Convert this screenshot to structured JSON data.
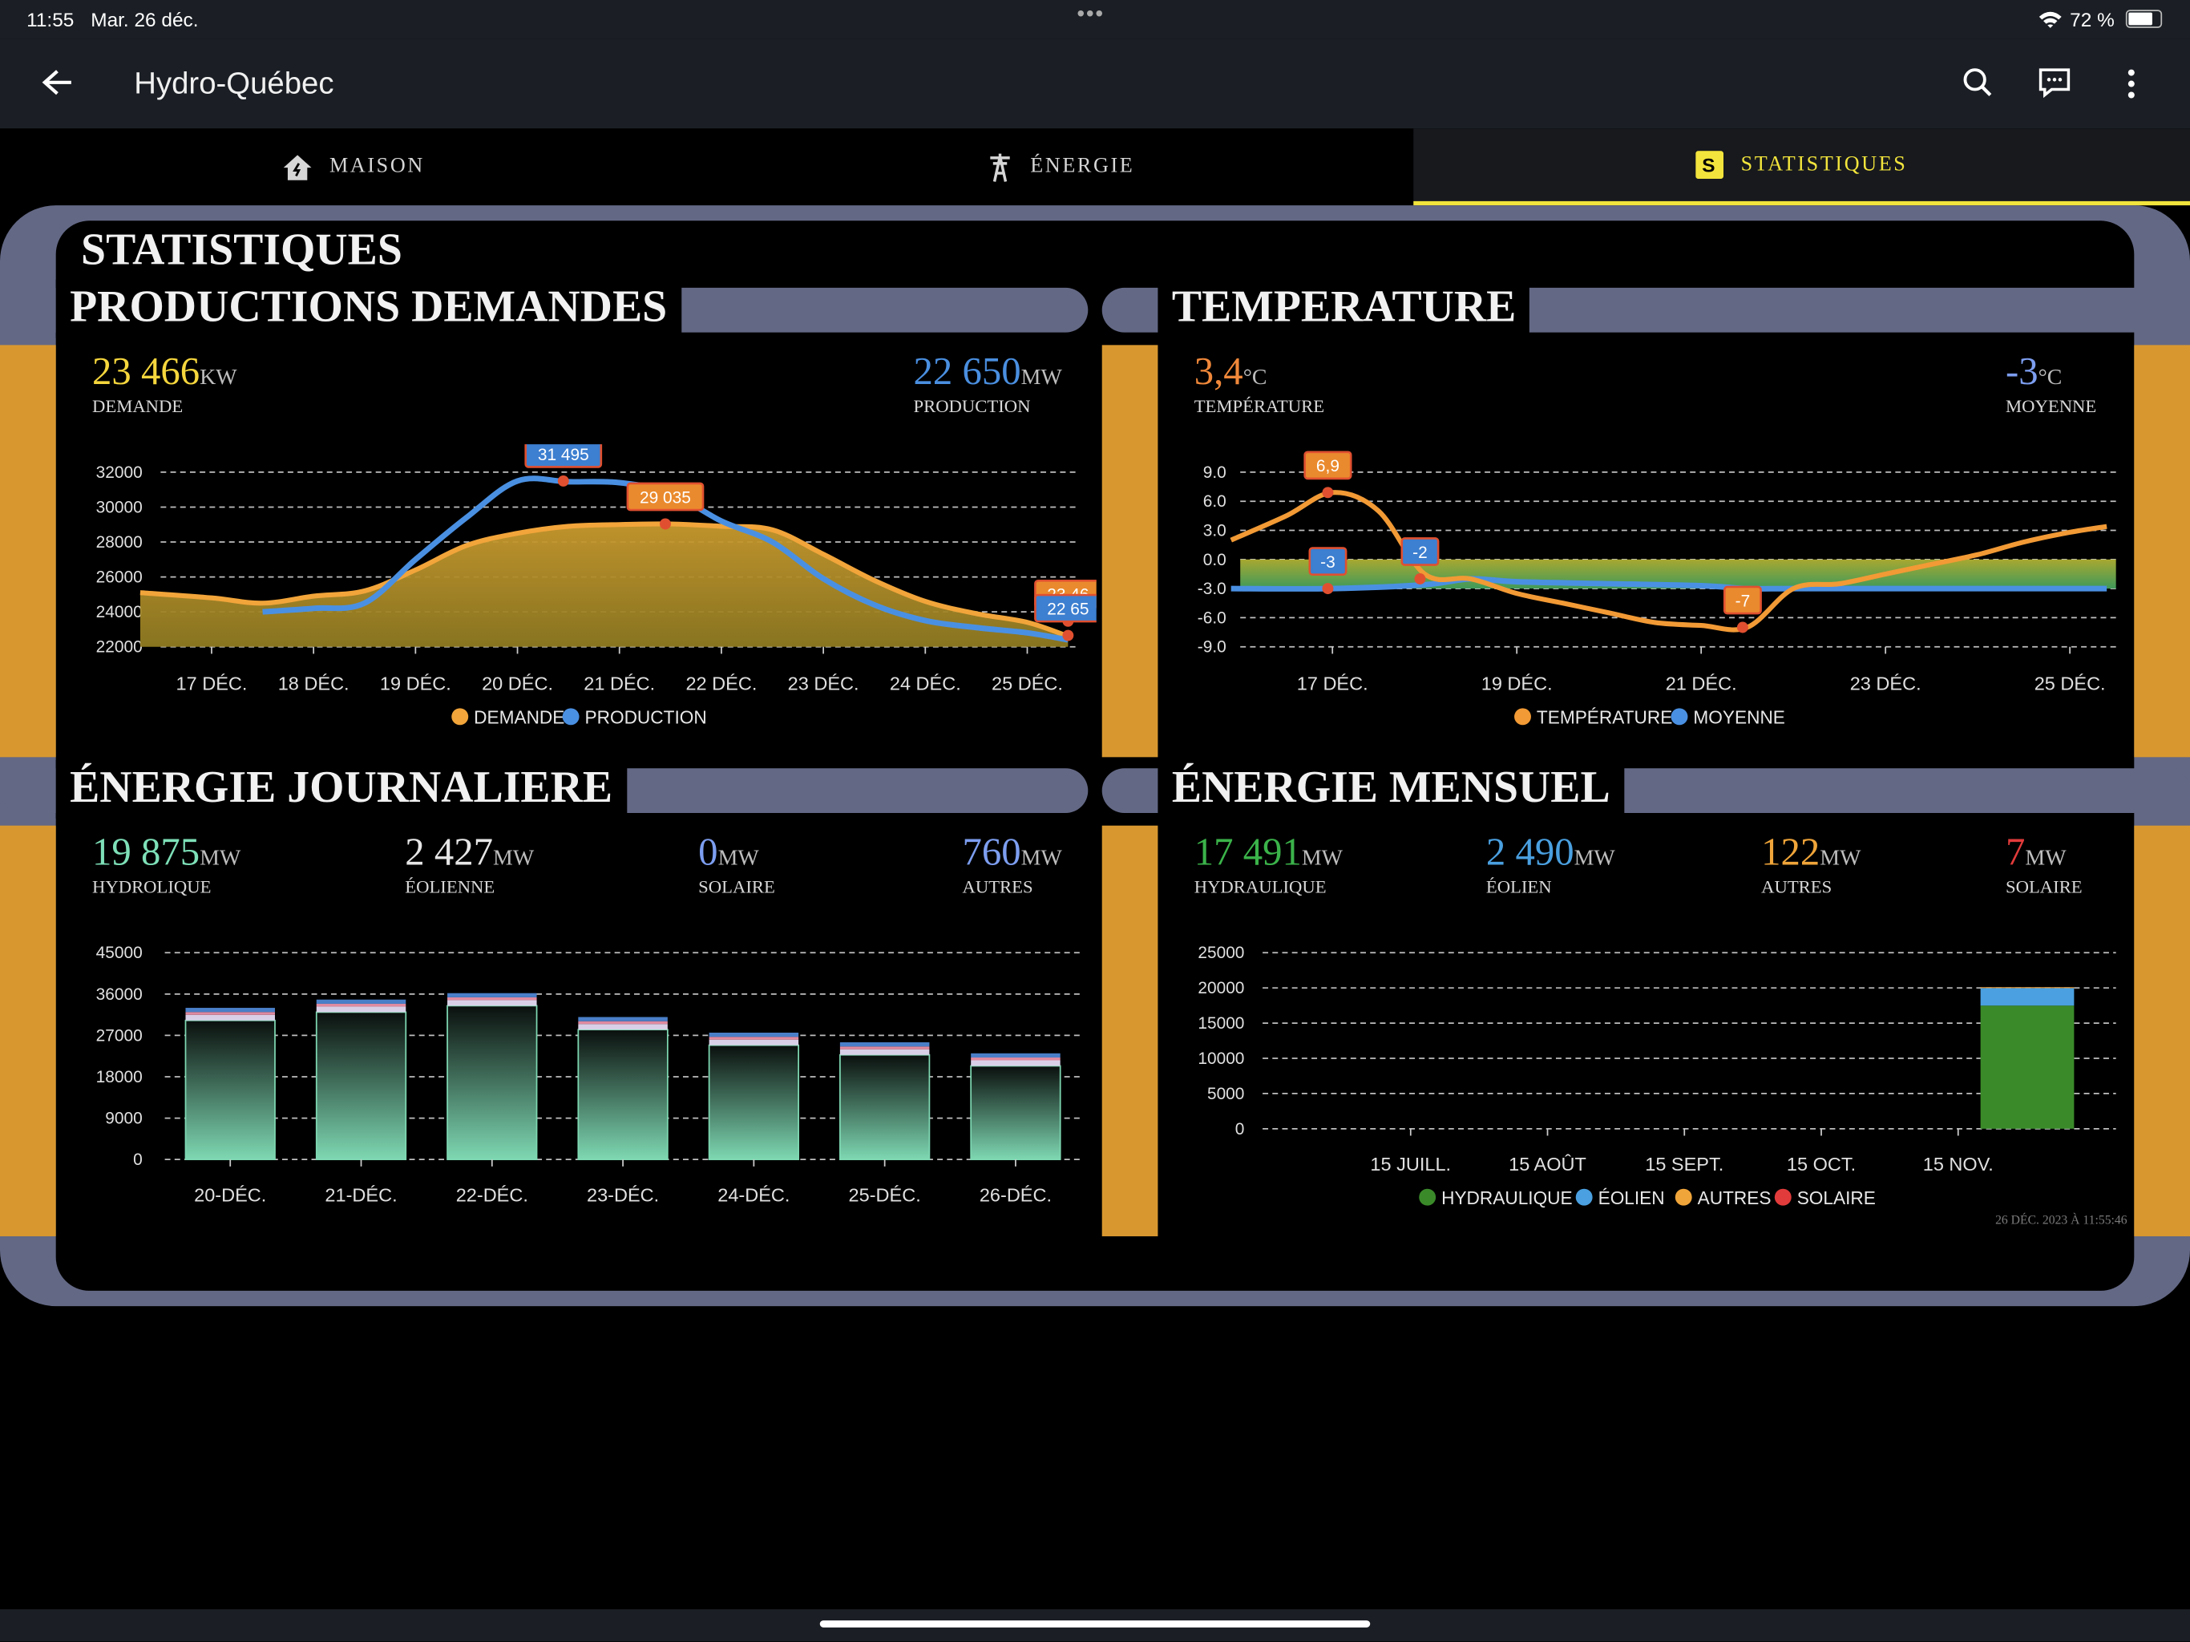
{
  "status": {
    "time": "11:55",
    "date": "Mar. 26 déc.",
    "battery": "72 %"
  },
  "app": {
    "title": "Hydro-Québec"
  },
  "tabs": [
    {
      "label": "MAISON"
    },
    {
      "label": "ÉNERGIE"
    },
    {
      "label": "STATISTIQUES"
    }
  ],
  "page_title": "STATISTIQUES",
  "panels": {
    "prod": {
      "title": "PRODUCTIONS DEMANDES",
      "stats": [
        {
          "value": "23 466",
          "unit": "KW",
          "label": "DEMANDE",
          "color": "#f5d63d"
        },
        {
          "value": "22 650",
          "unit": "MW",
          "label": "PRODUCTION",
          "color": "#4a8fe0"
        }
      ]
    },
    "temp": {
      "title": "TEMPERATURE",
      "stats": [
        {
          "value": "3,4",
          "unit": "°C",
          "label": "TEMPÉRATURE",
          "color": "#f0883a"
        },
        {
          "value": "-3",
          "unit": "°C",
          "label": "MOYENNE",
          "color": "#7d9ef0"
        }
      ]
    },
    "daily": {
      "title": "ÉNERGIE JOURNALIERE",
      "stats": [
        {
          "value": "19 875",
          "unit": "MW",
          "label": "HYDROLIQUE",
          "color": "#7ee0b8"
        },
        {
          "value": "2 427",
          "unit": "MW",
          "label": "ÉOLIENNE",
          "color": "#e6e6e6"
        },
        {
          "value": "0",
          "unit": "MW",
          "label": "SOLAIRE",
          "color": "#7d9ef0"
        },
        {
          "value": "760",
          "unit": "MW",
          "label": "AUTRES",
          "color": "#7d9ef0"
        }
      ]
    },
    "monthly": {
      "title": "ÉNERGIE MENSUEL",
      "stats": [
        {
          "value": "17 491",
          "unit": "MW",
          "label": "HYDRAULIQUE",
          "color": "#3bb34a"
        },
        {
          "value": "2 490",
          "unit": "MW",
          "label": "ÉOLIEN",
          "color": "#4aa0e0"
        },
        {
          "value": "122",
          "unit": "MW",
          "label": "AUTRES",
          "color": "#f0a53a"
        },
        {
          "value": "7",
          "unit": "MW",
          "label": "SOLAIRE",
          "color": "#e23b3b"
        }
      ]
    }
  },
  "timestamp": "26 DÉC. 2023 À 11:55:46",
  "chart_data": [
    {
      "type": "area",
      "xticks": [
        "17 DÉC.",
        "18 DÉC.",
        "19 DÉC.",
        "20 DÉC.",
        "21 DÉC.",
        "22 DÉC.",
        "23 DÉC.",
        "24 DÉC.",
        "25 DÉC."
      ],
      "yticks": [
        "32000",
        "30000",
        "28000",
        "26000",
        "24000",
        "22000"
      ],
      "ylim": [
        22000,
        32000
      ],
      "xlim": [
        16.5,
        25.5
      ],
      "series": [
        {
          "name": "DEMANDE",
          "color": "#f2a53a",
          "x": [
            16.3,
            17,
            17.5,
            18,
            18.5,
            19,
            19.5,
            20,
            20.5,
            21,
            21.5,
            22,
            22.5,
            23,
            23.5,
            24,
            24.5,
            25,
            25.4
          ],
          "values": [
            25100,
            24800,
            24500,
            24900,
            25200,
            26400,
            27800,
            28500,
            28900,
            29000,
            29035,
            28900,
            28700,
            27300,
            25800,
            24600,
            23900,
            23400,
            22600
          ]
        },
        {
          "name": "PRODUCTION",
          "color": "#4a90e2",
          "x": [
            17.5,
            18,
            18.5,
            19,
            19.5,
            20,
            20.5,
            21,
            21.5,
            22,
            22.5,
            23,
            23.5,
            24,
            24.5,
            25,
            25.4
          ],
          "values": [
            24000,
            24200,
            24500,
            27000,
            29400,
            31495,
            31450,
            31400,
            30800,
            29200,
            28000,
            25900,
            24400,
            23500,
            23100,
            22800,
            22400
          ]
        }
      ],
      "labels": [
        {
          "text": "31 495",
          "x": 20.45,
          "y": 31495,
          "color": "#3d7fd0"
        },
        {
          "text": "29 035",
          "x": 21.45,
          "y": 29035,
          "color": "#ea8a2e"
        },
        {
          "text": "23 46",
          "x": 25.4,
          "y": 23466,
          "color": "#ea8a2e"
        },
        {
          "text": "22 65",
          "x": 25.4,
          "y": 22650,
          "color": "#3d7fd0"
        }
      ],
      "legend": [
        {
          "name": "DEMANDE",
          "color": "#f2a53a"
        },
        {
          "name": "PRODUCTION",
          "color": "#4a90e2"
        }
      ]
    },
    {
      "type": "line",
      "xticks": [
        "17 DÉC.",
        "19 DÉC.",
        "21 DÉC.",
        "23 DÉC.",
        "25 DÉC."
      ],
      "yticks": [
        "9.0",
        "6.0",
        "3.0",
        "0.0",
        "-3.0",
        "-6.0",
        "-9.0"
      ],
      "ylim": [
        -9,
        9
      ],
      "xlim": [
        16,
        25.5
      ],
      "series": [
        {
          "name": "TEMPÉRATURE",
          "color": "#f29a35",
          "x": [
            15.9,
            16.5,
            17,
            17.5,
            18,
            18.5,
            19,
            19.5,
            20,
            20.5,
            21,
            21.5,
            22,
            22.5,
            23,
            23.5,
            24,
            24.5,
            25,
            25.4
          ],
          "values": [
            2,
            4.5,
            6.9,
            5,
            -1.5,
            -2,
            -3.5,
            -4.5,
            -5.5,
            -6.5,
            -6.8,
            -7,
            -3,
            -2.5,
            -1.5,
            -0.5,
            0.5,
            1.8,
            2.8,
            3.4
          ]
        },
        {
          "name": "MOYENNE",
          "color": "#4a90e2",
          "x": [
            15.9,
            17,
            18,
            18.5,
            19,
            20,
            21,
            21.5,
            22,
            23,
            24,
            25,
            25.4
          ],
          "values": [
            -3,
            -3,
            -2.6,
            -2,
            -2.3,
            -2.5,
            -2.7,
            -3,
            -3,
            -3,
            -3,
            -3,
            -3
          ]
        }
      ],
      "labels": [
        {
          "text": "6,9",
          "x": 16.95,
          "y": 6.9,
          "color": "#ea8a2e"
        },
        {
          "text": "-3",
          "x": 16.95,
          "y": -3,
          "color": "#3d7fd0"
        },
        {
          "text": "-2",
          "x": 17.95,
          "y": -2,
          "color": "#3d7fd0"
        },
        {
          "text": "-7",
          "x": 21.45,
          "y": -7,
          "color": "#ea8a2e"
        }
      ],
      "legend": [
        {
          "name": "TEMPÉRATURE",
          "color": "#f29a35"
        },
        {
          "name": "MOYENNE",
          "color": "#4a90e2"
        }
      ]
    },
    {
      "type": "bar",
      "categories": [
        "20-DÉC.",
        "21-DÉC.",
        "22-DÉC.",
        "23-DÉC.",
        "24-DÉC.",
        "25-DÉC.",
        "26-DÉC."
      ],
      "yticks": [
        "45000",
        "36000",
        "27000",
        "18000",
        "9000",
        "0"
      ],
      "ylim": [
        0,
        45000
      ],
      "values": [
        33000,
        34800,
        36200,
        31000,
        27600,
        25500,
        23100
      ]
    },
    {
      "type": "bar",
      "categories": [
        "15 JUILL.",
        "15 AOÛT",
        "15 SEPT.",
        "15 OCT.",
        "15 NOV."
      ],
      "yticks": [
        "25000",
        "20000",
        "15000",
        "10000",
        "5000",
        "0"
      ],
      "ylim": [
        0,
        25000
      ],
      "series": [
        {
          "name": "HYDRAULIQUE",
          "color": "#3a8a2a",
          "values": [
            0,
            0,
            0,
            0,
            0,
            17491
          ]
        },
        {
          "name": "ÉOLIEN",
          "color": "#4aa0e0",
          "values": [
            0,
            0,
            0,
            0,
            0,
            2490
          ]
        },
        {
          "name": "AUTRES",
          "color": "#f0a53a",
          "values": [
            0,
            0,
            0,
            0,
            0,
            122
          ]
        },
        {
          "name": "SOLAIRE",
          "color": "#e23b3b",
          "values": [
            0,
            0,
            0,
            0,
            0,
            7
          ]
        }
      ],
      "legend": [
        {
          "name": "HYDRAULIQUE",
          "color": "#3a8a2a"
        },
        {
          "name": "ÉOLIEN",
          "color": "#4aa0e0"
        },
        {
          "name": "AUTRES",
          "color": "#f0a53a"
        },
        {
          "name": "SOLAIRE",
          "color": "#e23b3b"
        }
      ]
    }
  ]
}
